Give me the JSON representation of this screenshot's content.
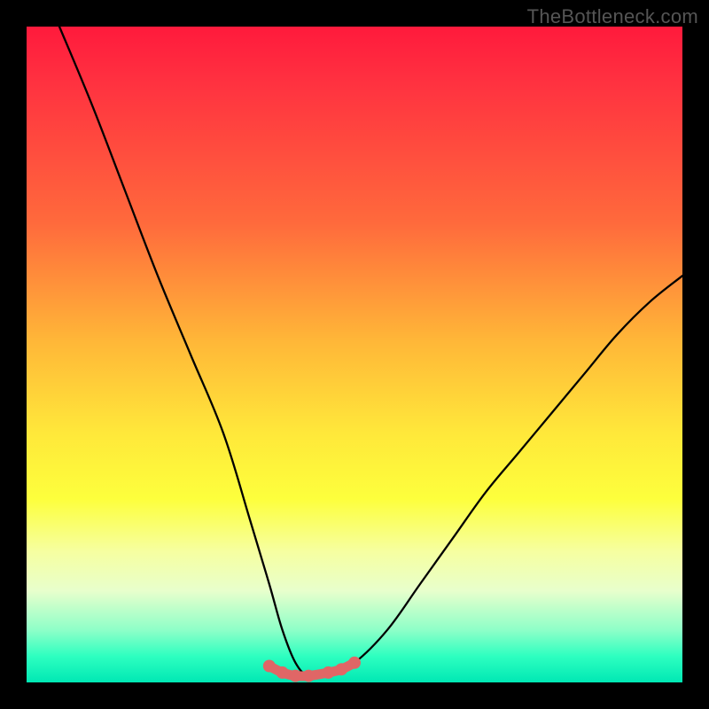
{
  "watermark": "TheBottleneck.com",
  "colors": {
    "background": "#000000",
    "curve": "#000000",
    "highlight": "#e06666",
    "gradient_top": "#ff1a3c",
    "gradient_bottom": "#00e8b4"
  },
  "chart_data": {
    "type": "line",
    "title": "",
    "xlabel": "",
    "ylabel": "",
    "xlim": [
      0,
      100
    ],
    "ylim": [
      0,
      100
    ],
    "grid": false,
    "legend": false,
    "series": [
      {
        "name": "bottleneck-curve",
        "x": [
          5,
          10,
          15,
          20,
          25,
          30,
          34,
          37,
          39,
          41,
          43,
          46,
          50,
          55,
          60,
          65,
          70,
          75,
          80,
          85,
          90,
          95,
          100
        ],
        "y": [
          100,
          88,
          75,
          62,
          50,
          38,
          25,
          15,
          8,
          3,
          1,
          1,
          3,
          8,
          15,
          22,
          29,
          35,
          41,
          47,
          53,
          58,
          62
        ]
      },
      {
        "name": "bottom-highlight",
        "x": [
          37,
          39,
          41,
          43,
          46,
          48,
          50
        ],
        "y": [
          2.5,
          1.5,
          1,
          1,
          1.5,
          2,
          3
        ]
      }
    ]
  }
}
